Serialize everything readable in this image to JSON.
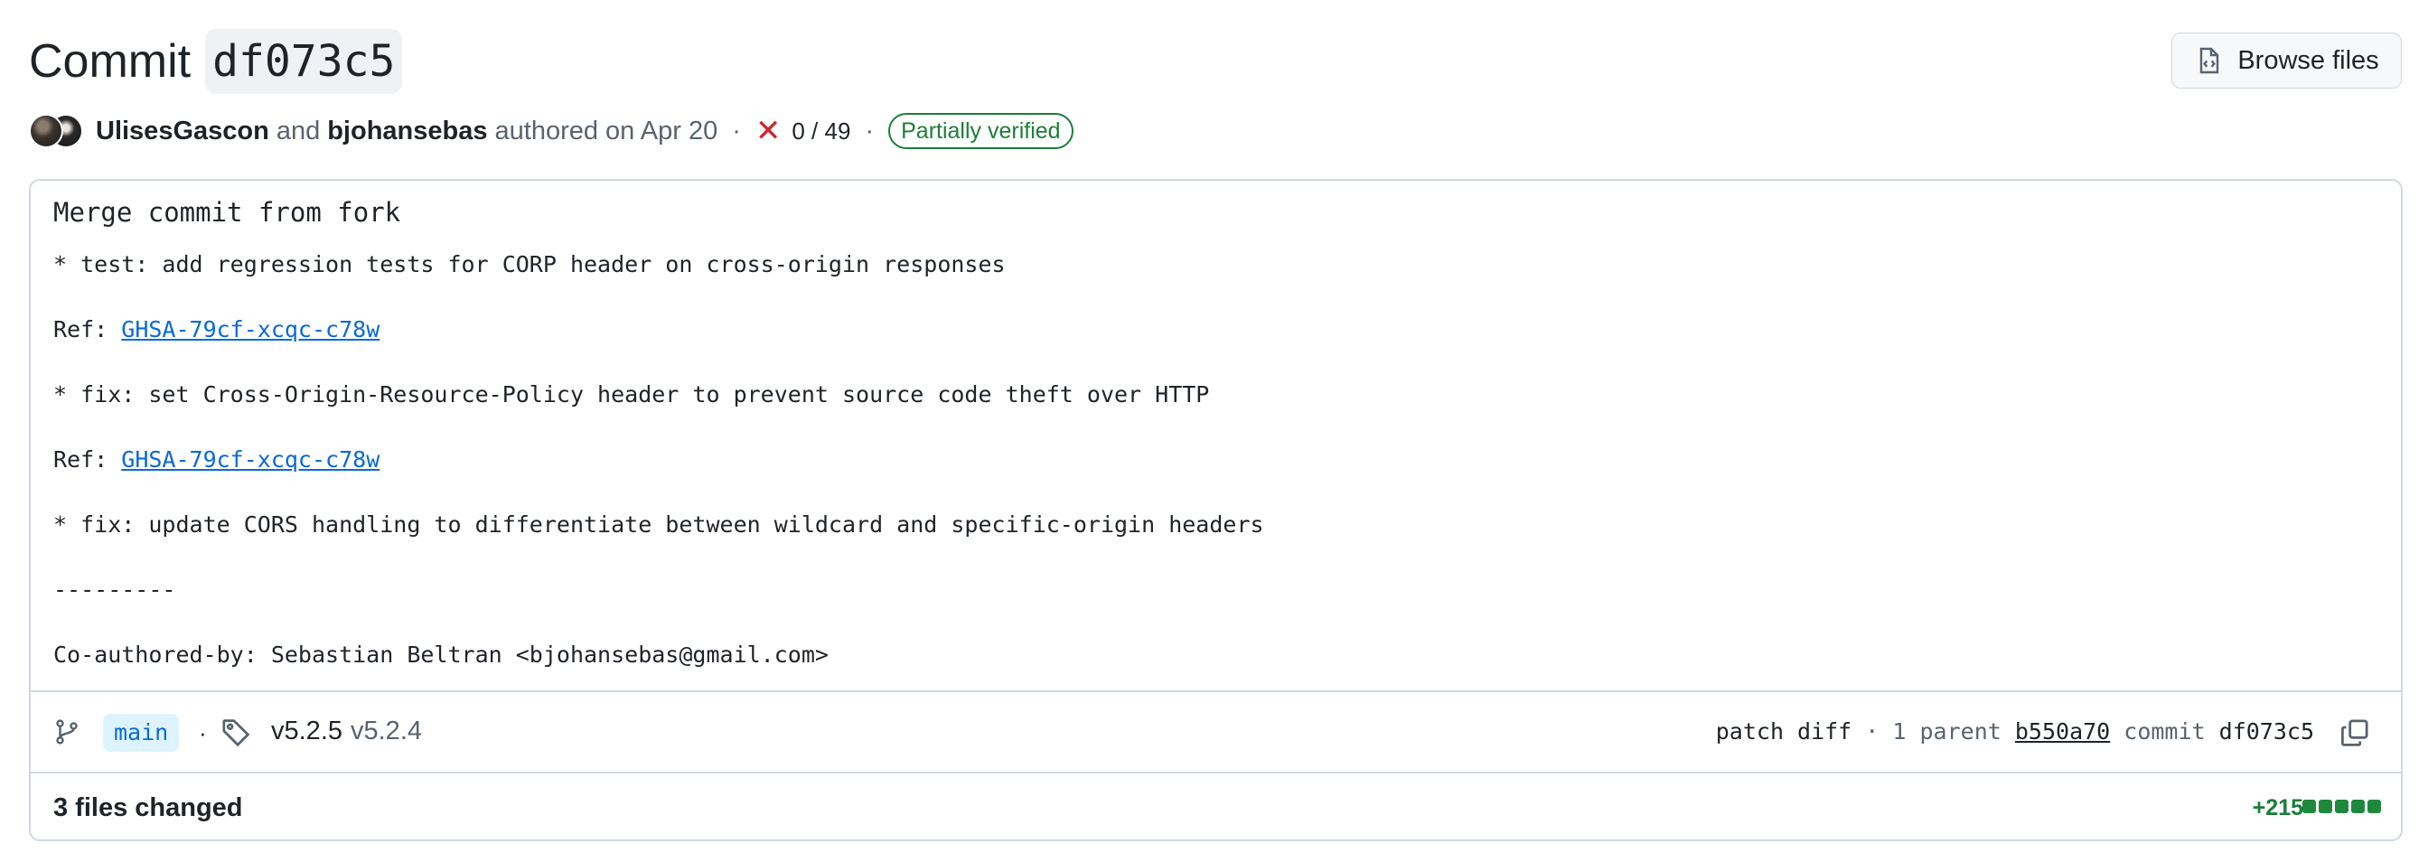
{
  "header": {
    "title_word": "Commit",
    "sha": "df073c5",
    "browse_files_label": "Browse files"
  },
  "authors": {
    "first": "UlisesGascon",
    "joiner": "and",
    "second": "bjohansebas",
    "authored_text": "authored on Apr 20",
    "separator": "·",
    "checks_icon": "x-icon",
    "checks_status": "0 / 49",
    "verification_badge": "Partially verified"
  },
  "message": {
    "summary": "Merge commit from fork",
    "lines": [
      "* test: add regression tests for CORP header on cross-origin responses",
      "* fix: set Cross-Origin-Resource-Policy header to prevent source code theft over HTTP",
      "* fix: update CORS handling to differentiate between wildcard and specific-origin headers",
      "---------",
      "Co-authored-by: Sebastian Beltran <bjohansebas@gmail.com>"
    ],
    "ref_label": "Ref: ",
    "ref_link": "GHSA-79cf-xcqc-c78w"
  },
  "meta": {
    "branch": "main",
    "dot": "·",
    "tags": [
      "v5.2.5",
      "v5.2.4"
    ],
    "patch_label": "patch",
    "diff_label": "diff",
    "parent_text": " · 1 parent ",
    "parent_sha": "b550a70",
    "commit_label": " commit ",
    "commit_sha": "df073c5"
  },
  "files": {
    "changed_label": "3 files changed",
    "additions": "+215",
    "diffstat_blocks": 5
  },
  "colors": {
    "link": "#0969da",
    "success": "#1a7f37",
    "danger": "#d1242f",
    "border": "#d1d9e0"
  }
}
